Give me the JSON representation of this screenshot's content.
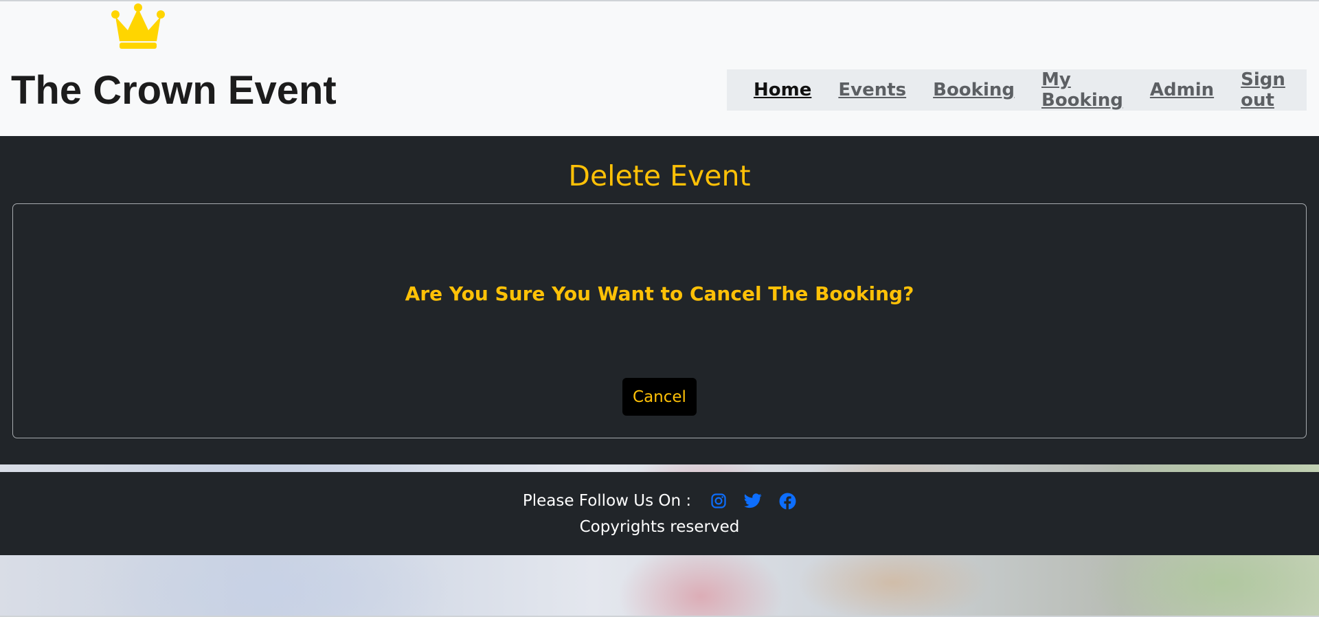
{
  "header": {
    "brand": "The Crown Event",
    "logo_icon": "crown-icon",
    "logo_color": "#ffd500"
  },
  "nav": {
    "items": [
      {
        "label": "Home",
        "active": true
      },
      {
        "label": "Events",
        "active": false
      },
      {
        "label": "Booking",
        "active": false
      },
      {
        "label": "My Booking",
        "active": false
      },
      {
        "label": "Admin",
        "active": false
      },
      {
        "label": "Sign out",
        "active": false
      }
    ]
  },
  "main": {
    "title": "Delete Event",
    "question": "Are You Sure You Want to Cancel The Booking?",
    "cancel_label": "Cancel"
  },
  "footer": {
    "follow_text": "Please Follow Us On :",
    "social": [
      "instagram-icon",
      "twitter-icon",
      "facebook-icon"
    ],
    "copyright": "Copyrights reserved"
  },
  "colors": {
    "accent": "#ffc107",
    "dark": "#212529",
    "link": "#0d6efd"
  }
}
